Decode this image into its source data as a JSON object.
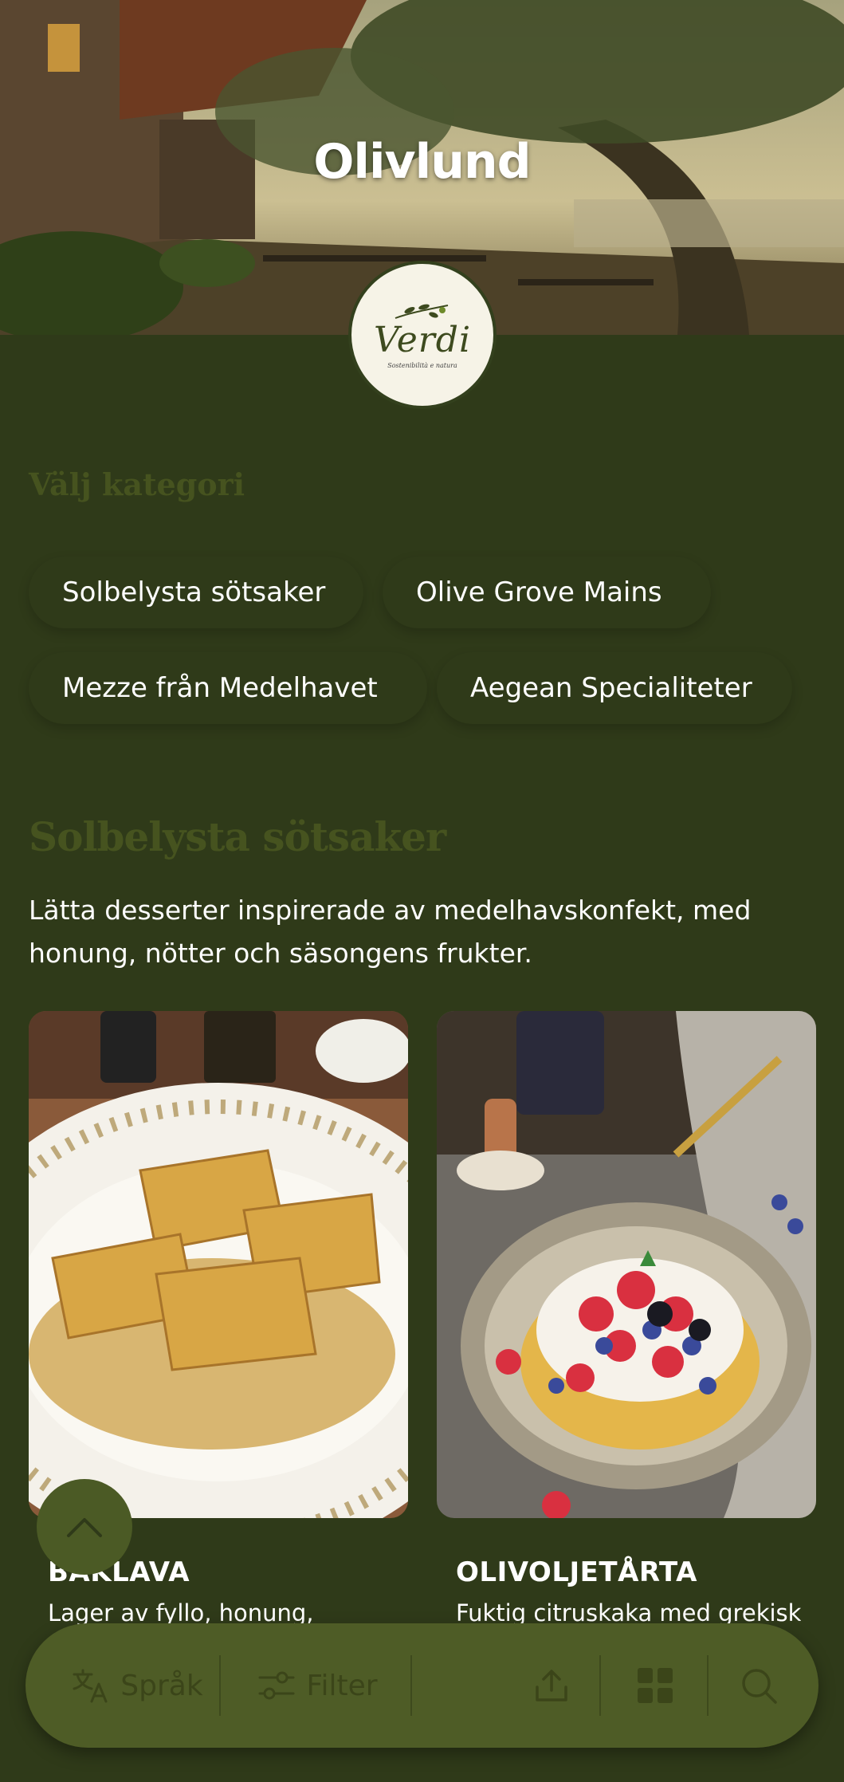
{
  "hero": {
    "title": "Olivlund"
  },
  "logo": {
    "name": "Verdi",
    "tagline": "Sostenibilità e natura"
  },
  "categories": {
    "heading": "Välj kategori",
    "items": [
      "Solbelysta sötsaker",
      "Olive Grove Mains",
      "Mezze från Medelhavet",
      "Aegean Specialiteter"
    ]
  },
  "section": {
    "title": "Solbelysta sötsaker",
    "description": "Lätta desserter inspirerade av medelhavskonfekt, med honung, nötter och säsongens frukter."
  },
  "products": [
    {
      "title": "BAKLAVA",
      "description": "Lager av fyllo, honung,"
    },
    {
      "title": "OLIVOLJETÅRTA",
      "description": "Fuktig citruskaka med grekisk"
    }
  ],
  "bottom_bar": {
    "language_label": "Språk",
    "filter_label": "Filter",
    "icons": [
      "translate-icon",
      "filter-icon",
      "share-icon",
      "grid-icon",
      "search-icon",
      "chevron-up-icon"
    ]
  },
  "colors": {
    "background": "#2f3a19",
    "accent": "#4e5c26",
    "muted": "#46531f"
  }
}
